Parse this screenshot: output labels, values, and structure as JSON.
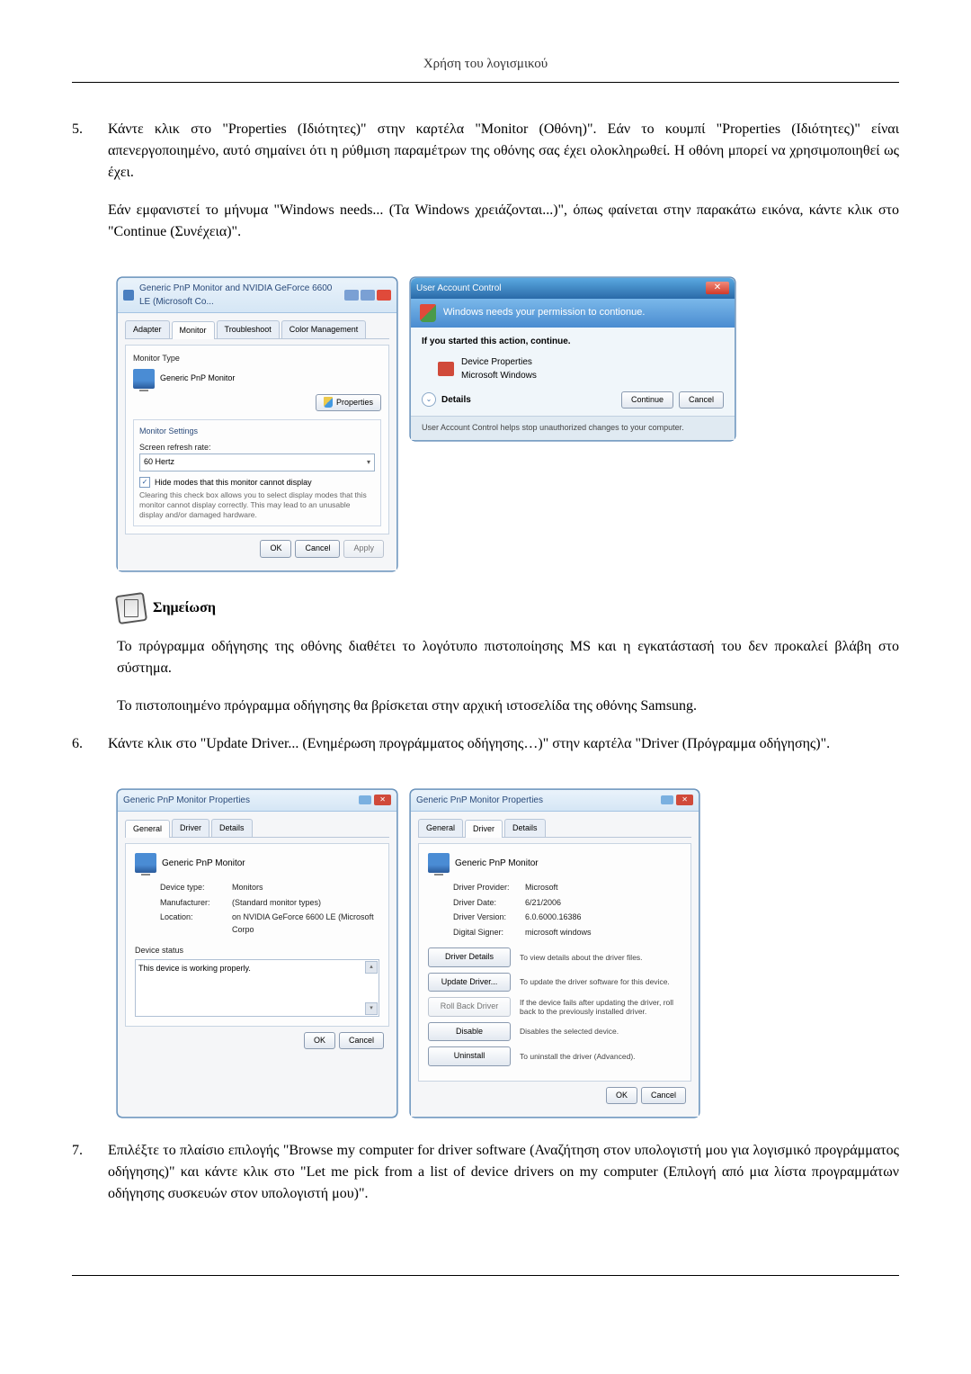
{
  "header": {
    "title": "Χρήση του λογισμικού"
  },
  "step5": {
    "number": "5.",
    "text1": "Κάντε κλικ στο \"Properties (Ιδιότητες)\" στην καρτέλα \"Monitor (Οθόνη)\". Εάν το κουμπί \"Properties (Ιδιότητες)\" είναι απενεργοποιημένο, αυτό σημαίνει ότι η ρύθμιση παραμέτρων της οθόνης σας έχει ολοκληρωθεί. Η οθόνη μπορεί να χρησιμοποιηθεί ως έχει.",
    "text2": "Εάν εμφανιστεί το μήνυμα \"Windows needs... (Τα Windows χρειάζονται...)\", όπως φαίνεται στην παρακάτω εικόνα, κάντε κλικ στο \"Continue (Συνέχεια)\"."
  },
  "monitorDialog": {
    "title": "Generic PnP Monitor and NVIDIA GeForce 6600 LE (Microsoft Co...",
    "tabs": {
      "adapter": "Adapter",
      "monitor": "Monitor",
      "troubleshoot": "Troubleshoot",
      "color": "Color Management"
    },
    "monitorTypeLabel": "Monitor Type",
    "monitorName": "Generic PnP Monitor",
    "propertiesBtn": "Properties",
    "settingsLabel": "Monitor Settings",
    "refreshLabel": "Screen refresh rate:",
    "refreshValue": "60 Hertz",
    "hideModesLabel": "Hide modes that this monitor cannot display",
    "hideModesHelp": "Clearing this check box allows you to select display modes that this monitor cannot display correctly. This may lead to an unusable display and/or damaged hardware.",
    "ok": "OK",
    "cancel": "Cancel",
    "apply": "Apply"
  },
  "uacDialog": {
    "title": "User Account Control",
    "banner": "Windows needs your permission to contionue.",
    "ifYouStarted": "If you started this action, continue.",
    "devProps": "Device Properties",
    "msWindows": "Microsoft Windows",
    "details": "Details",
    "continue": "Continue",
    "cancel": "Cancel",
    "footer": "User Account Control helps stop unauthorized changes to your computer."
  },
  "note": {
    "label": "Σημείωση",
    "text1": "Το πρόγραμμα οδήγησης της οθόνης διαθέτει το λογότυπο πιστοποίησης MS και η εγκατάστασή του δεν προκαλεί βλάβη στο σύστημα.",
    "text2": "Το πιστοποιημένο πρόγραμμα οδήγησης θα βρίσκεται στην αρχική ιστοσελίδα της οθόνης Samsung."
  },
  "step6": {
    "number": "6.",
    "text": "Κάντε κλικ στο \"Update Driver... (Ενημέρωση προγράμματος οδήγησης…)\" στην καρτέλα \"Driver (Πρόγραμμα οδήγησης)\"."
  },
  "propsGeneral": {
    "title": "Generic PnP Monitor Properties",
    "tabs": {
      "general": "General",
      "driver": "Driver",
      "details": "Details"
    },
    "monitorName": "Generic PnP Monitor",
    "deviceTypeLabel": "Device type:",
    "deviceType": "Monitors",
    "manufacturerLabel": "Manufacturer:",
    "manufacturer": "(Standard monitor types)",
    "locationLabel": "Location:",
    "location": "on NVIDIA GeForce 6600 LE (Microsoft Corpo",
    "deviceStatusLabel": "Device status",
    "deviceStatus": "This device is working properly.",
    "ok": "OK",
    "cancel": "Cancel"
  },
  "propsDriver": {
    "title": "Generic PnP Monitor Properties",
    "tabs": {
      "general": "General",
      "driver": "Driver",
      "details": "Details"
    },
    "monitorName": "Generic PnP Monitor",
    "providerLabel": "Driver Provider:",
    "provider": "Microsoft",
    "dateLabel": "Driver Date:",
    "date": "6/21/2006",
    "versionLabel": "Driver Version:",
    "version": "6.0.6000.16386",
    "signerLabel": "Digital Signer:",
    "signer": "microsoft windows",
    "btnDetails": "Driver Details",
    "descDetails": "To view details about the driver files.",
    "btnUpdate": "Update Driver...",
    "descUpdate": "To update the driver software for this device.",
    "btnRollback": "Roll Back Driver",
    "descRollback": "If the device fails after updating the driver, roll back to the previously installed driver.",
    "btnDisable": "Disable",
    "descDisable": "Disables the selected device.",
    "btnUninstall": "Uninstall",
    "descUninstall": "To uninstall the driver (Advanced).",
    "ok": "OK",
    "cancel": "Cancel"
  },
  "step7": {
    "number": "7.",
    "text": "Επιλέξτε το πλαίσιο επιλογής \"Browse my computer for driver software (Αναζήτηση στον υπολογιστή μου για λογισμικό προγράμματος οδήγησης)\" και κάντε κλικ στο \"Let me pick from a list of device drivers on my computer (Επιλογή από μια λίστα προγραμμάτων οδήγησης συσκευών στον υπολογιστή μου)\"."
  }
}
